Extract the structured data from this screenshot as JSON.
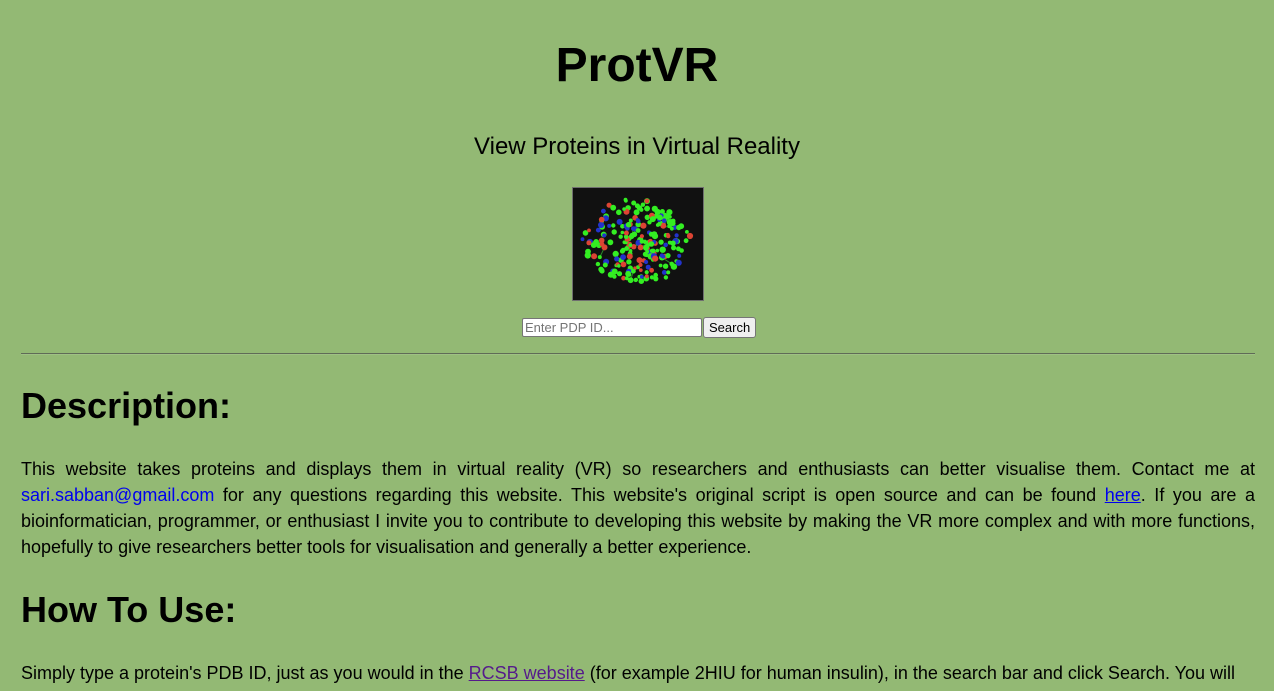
{
  "header": {
    "title": "ProtVR",
    "subtitle": "View Proteins in Virtual Reality"
  },
  "search": {
    "placeholder": "Enter PDP ID...",
    "value": "",
    "button_label": "Search"
  },
  "description": {
    "heading": "Description:",
    "text_1": "This website takes proteins and displays them in virtual reality (VR) so researchers and enthusiasts can better visualise them. Contact me at ",
    "email": "sari.sabban@gmail.com",
    "text_2": " for any questions regarding this website. This website's original script is open source and can be found ",
    "source_link": "here",
    "text_3": ". If you are a bioinformatician, programmer, or enthusiast I invite you to contribute to developing this website by making the VR more complex and with more functions, hopefully to give researchers better tools for visualisation and generally a better experience."
  },
  "how_to_use": {
    "heading": "How To Use:",
    "text_1": "Simply type a protein's PDB ID, just as you would in the ",
    "rcsb_link": "RCSB website",
    "text_2": " (for example 2HIU for human insulin), in the search bar and click Search. You will"
  },
  "colors": {
    "background": "#93b974",
    "image_background": "#111111",
    "atom_green": "#33ee22",
    "atom_red": "#dd4433",
    "atom_blue": "#2233cc",
    "link": "#0000ee",
    "visited_link": "#551a8b"
  }
}
